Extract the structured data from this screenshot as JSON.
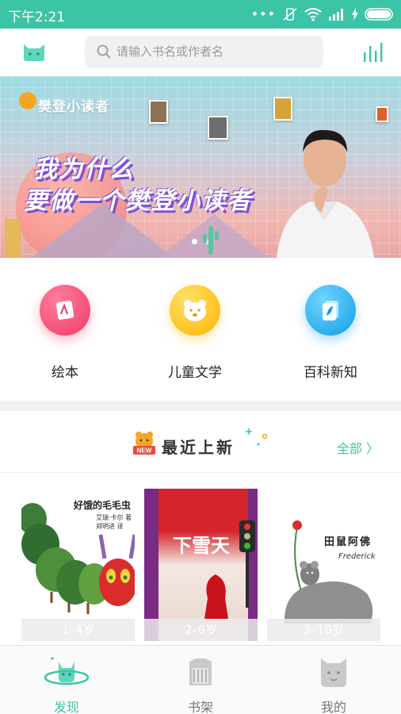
{
  "status_bar": {
    "time": "下午2:21"
  },
  "header": {
    "search_placeholder": "请输入书名或作者名"
  },
  "banner": {
    "brand": "樊登小读者",
    "headline_line1": "我为什么",
    "headline_line2": "要做一个樊登小读者",
    "page_count": 2,
    "active_page": 0
  },
  "categories": [
    {
      "label": "绘本",
      "icon": "picture-book-icon",
      "color": "#f25478"
    },
    {
      "label": "儿童文学",
      "icon": "bear-face-icon",
      "color": "#ffc51e"
    },
    {
      "label": "百科新知",
      "icon": "encyclopedia-icon",
      "color": "#2cb8f0"
    }
  ],
  "recent": {
    "title": "最近上新",
    "badge": "NEW",
    "all_label": "全部 〉",
    "books": [
      {
        "cover_title": "好饿的毛毛虫",
        "cover_author": "艾瑞·卡尔 著",
        "cover_translator": "郑明进 译",
        "age": "1–4岁"
      },
      {
        "cover_title": "下雪天",
        "age": "2–6岁"
      },
      {
        "cover_title": "田鼠阿佛",
        "cover_signature": "Frederick",
        "age": "3–10岁"
      }
    ]
  },
  "tabs": [
    {
      "label": "发现",
      "icon": "discover-planet-icon",
      "active": true
    },
    {
      "label": "书架",
      "icon": "bookshelf-icon",
      "active": false
    },
    {
      "label": "我的",
      "icon": "profile-icon",
      "active": false
    }
  ],
  "colors": {
    "accent": "#3cc4a6",
    "status_bar": "#3cc4a6"
  }
}
